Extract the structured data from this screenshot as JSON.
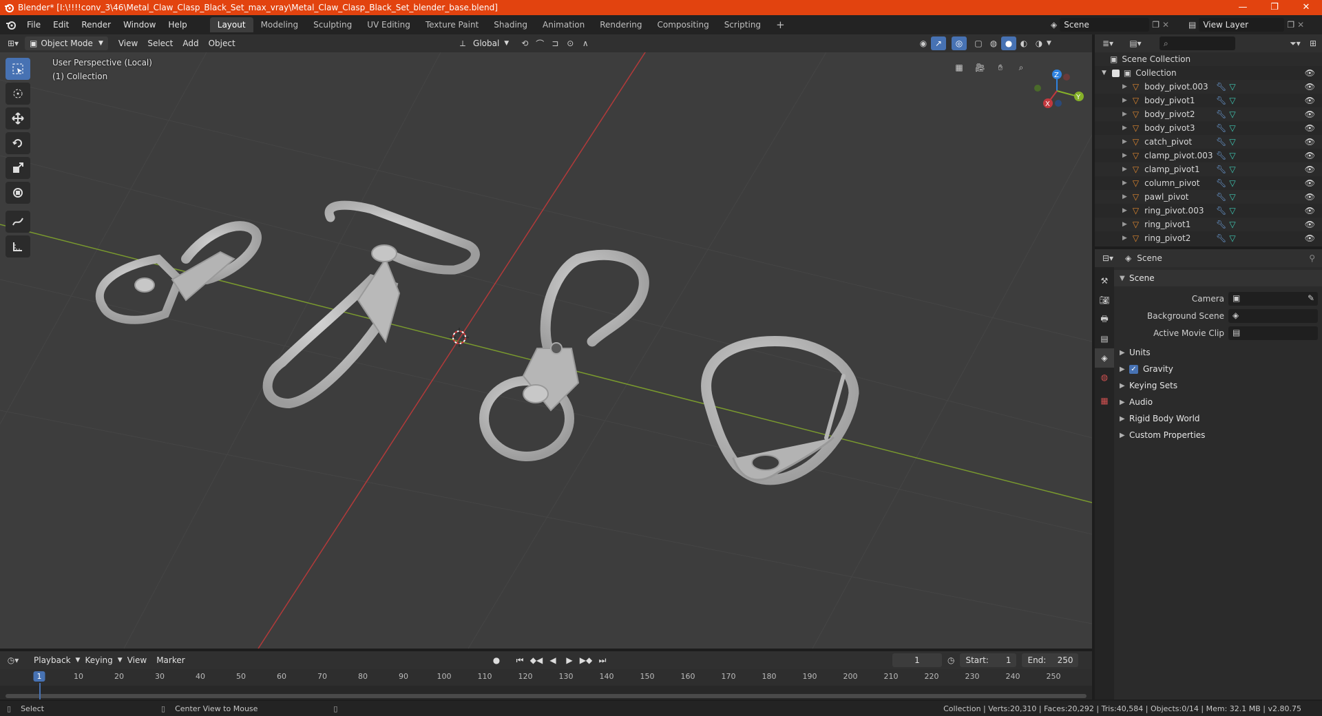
{
  "window": {
    "title": "Blender* [I:\\!!!!conv_3\\46\\Metal_Claw_Clasp_Black_Set_max_vray\\Metal_Claw_Clasp_Black_Set_blender_base.blend]",
    "controls": [
      "—",
      "❐",
      "✕"
    ]
  },
  "menu": [
    "File",
    "Edit",
    "Render",
    "Window",
    "Help"
  ],
  "workspaces": {
    "tabs": [
      "Layout",
      "Modeling",
      "Sculpting",
      "UV Editing",
      "Texture Paint",
      "Shading",
      "Animation",
      "Rendering",
      "Compositing",
      "Scripting"
    ],
    "active": "Layout",
    "add": "+"
  },
  "scene_selector": "Scene",
  "view_layer_selector": "View Layer",
  "viewport_header": {
    "mode": "Object Mode",
    "menus": [
      "View",
      "Select",
      "Add",
      "Object"
    ],
    "orientation": "Global"
  },
  "viewport": {
    "perspective_label": "User Perspective (Local)",
    "collection_label": "(1) Collection",
    "gizmo_axes": [
      "Z",
      "Y",
      "X"
    ]
  },
  "outliner": {
    "search_placeholder": "",
    "scene_collection": "Scene Collection",
    "collection": "Collection",
    "objects": [
      "body_pivot.003",
      "body_pivot1",
      "body_pivot2",
      "body_pivot3",
      "catch_pivot",
      "clamp_pivot.003",
      "clamp_pivot1",
      "column_pivot",
      "pawl_pivot",
      "ring_pivot.003",
      "ring_pivot1",
      "ring_pivot2"
    ]
  },
  "properties": {
    "context": "Scene",
    "panel_title": "Scene",
    "fields": [
      {
        "label": "Camera",
        "value": ""
      },
      {
        "label": "Background Scene",
        "value": ""
      },
      {
        "label": "Active Movie Clip",
        "value": ""
      }
    ],
    "subpanels": [
      "Units",
      "Gravity",
      "Keying Sets",
      "Audio",
      "Rigid Body World",
      "Custom Properties"
    ],
    "gravity_checked": true
  },
  "timeline": {
    "menus": [
      "Playback",
      "Keying",
      "View",
      "Marker"
    ],
    "current_frame": "1",
    "start_label": "Start:",
    "start": "1",
    "end_label": "End:",
    "end": "250",
    "ticks": [
      "1",
      "10",
      "20",
      "30",
      "40",
      "50",
      "60",
      "70",
      "80",
      "90",
      "100",
      "110",
      "120",
      "130",
      "140",
      "150",
      "160",
      "170",
      "180",
      "190",
      "200",
      "210",
      "220",
      "230",
      "240",
      "250"
    ]
  },
  "statusbar": {
    "left_action": "Select",
    "middle_action": "Center View to Mouse",
    "stats": "Collection | Verts:20,310 | Faces:20,292 | Tris:40,584 | Objects:0/14 | Mem: 32.1 MB | v2.80.75"
  },
  "colors": {
    "titlebar": "#e2430f",
    "active_blue": "#4772b3",
    "x_axis": "#c3383e",
    "y_axis": "#86b129",
    "z_axis": "#2f83e0",
    "object_orange": "#e0882f",
    "mesh_cyan": "#3fc9b4"
  }
}
